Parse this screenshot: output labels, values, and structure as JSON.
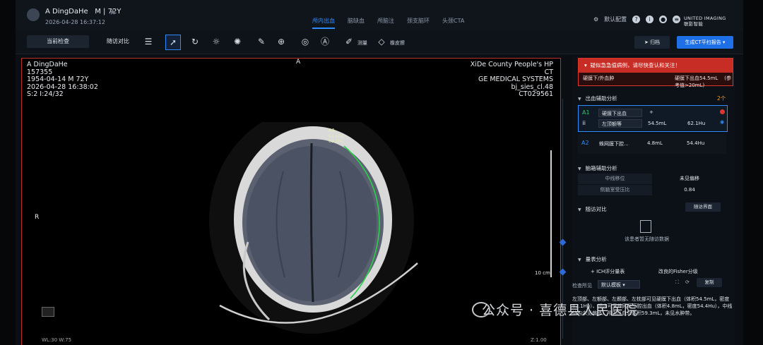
{
  "header": {
    "patient_name": "A DingDaHe",
    "patient_meta": "M | 72Y",
    "datetime": "2026-04-28 16:37:12",
    "tabs": [
      "颅内出血",
      "脑缺血",
      "颅脑注",
      "颈支脑环",
      "头颈CTA"
    ],
    "active_tab": "颅内出血",
    "config_label": "默认配置",
    "brand_line1": "UNITED IMAGING",
    "brand_line2": "联影智能"
  },
  "toolbar": {
    "current_exam": "当前检查",
    "follow_compare": "随访对比",
    "measure_label": "测量",
    "eraser_label": "橡皮擦",
    "send_label": "归档",
    "report_label": "生成CT平扫报告"
  },
  "viewer": {
    "top_left": [
      "A DingDaHe",
      "157355",
      "1954-04-14 M 72Y",
      "2026-04-28 16:38:02",
      "S:2 I:24/32"
    ],
    "top_right": [
      "XiDe County People's HP",
      "CT",
      "GE MEDICAL SYSTEMS",
      "bj_sies_cl.48",
      "CT029561"
    ],
    "orient_top": "A",
    "orient_left": "R",
    "roi_label": "A1",
    "roi_volume": "54.5mL",
    "roi_hu": "62.1Hu",
    "scale_label": "10 cm",
    "bottom_left": "WL:30 W:75",
    "bottom_right": "Z:1.00"
  },
  "panel": {
    "alert_title": "疑似急急值病例，请尽快查认和关注！",
    "alert_type": "硬膜下/外血肿",
    "alert_value": "硬膜下出血54.5mL",
    "alert_ref": "(参考值>20mL)",
    "bleed_section": "出血辅助分析",
    "bleed_count": "2个",
    "a1": {
      "tag": "A1",
      "type": "硬膜下出血",
      "region": "左顶额等",
      "volume": "54.5mL",
      "hu": "62.1Hu"
    },
    "a2": {
      "tag": "A2",
      "type": "蛛网膜下腔...",
      "volume": "4.8mL",
      "hu": "54.4Hu"
    },
    "brain_section": "脑箱辅助分析",
    "brain_rows": [
      {
        "k": "中线移位",
        "v": "未见偏移"
      },
      {
        "k": "侧脑室受压比",
        "v": "0.84"
      }
    ],
    "followup_section": "随访对比",
    "followup_btn": "随访界面",
    "followup_empty": "该患者暂无随访数据",
    "score_section": "量表分析",
    "ich_label": "ICH评分量表",
    "fisher_label": "改良的Fisher分级",
    "exam_label": "检查所见",
    "exam_select": "默认模板",
    "copy_btn": "复制",
    "findings": "左顶部、左额部、左颞部、左枕部可见硬膜下出血（体积54.5mL，密度62.1Hu）、颅内可见蛛网膜下腔出血（体积4.8mL，密度54.4Hu），中线结构未见偏移。颅内出血总体积59.3mL，未见水肿带。"
  },
  "watermark": "公众号 · 喜德县人民医院"
}
